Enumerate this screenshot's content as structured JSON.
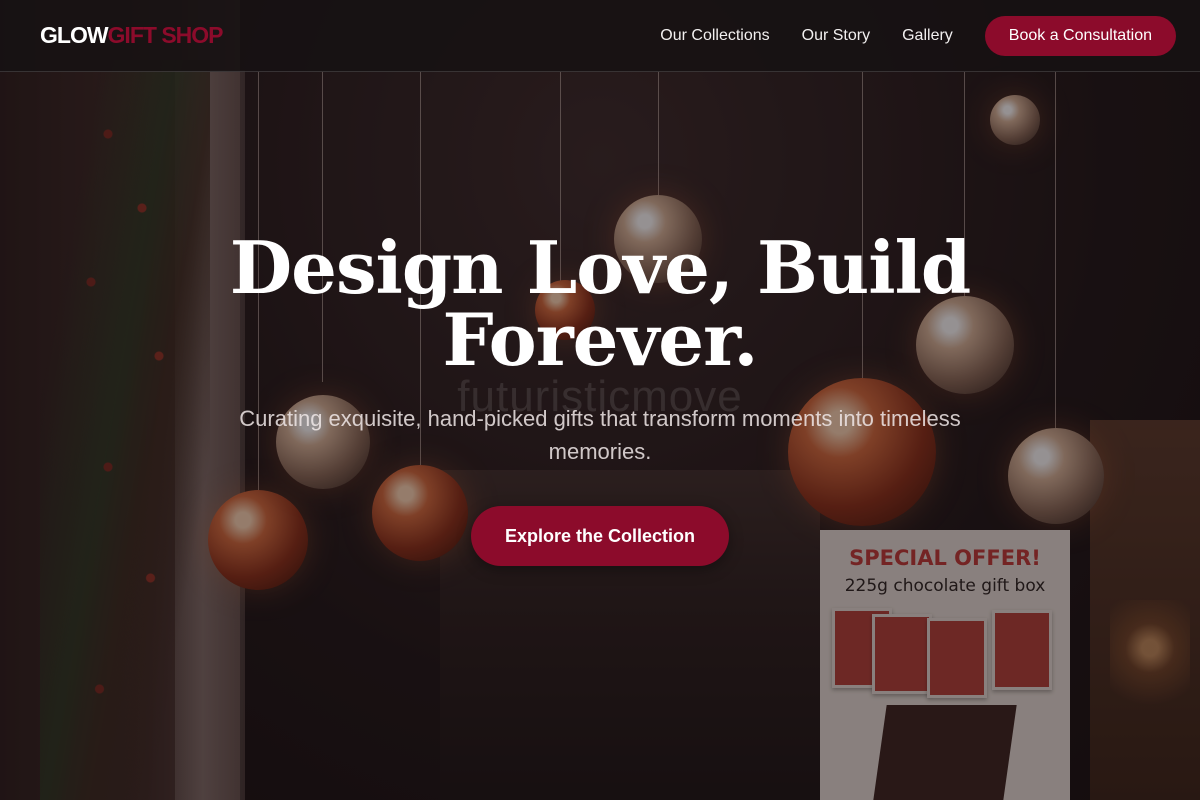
{
  "header": {
    "logo_main": "GLOW",
    "logo_accent": "GIFT SHOP",
    "nav": [
      {
        "label": "Our Collections"
      },
      {
        "label": "Our Story"
      },
      {
        "label": "Gallery"
      }
    ],
    "cta_label": "Book a Consultation"
  },
  "hero": {
    "title": "Design Love, Build Forever.",
    "subtitle": "Curating exquisite, hand-picked gifts that transform moments into timeless memories.",
    "watermark": "futuristicmove",
    "cta_label": "Explore the Collection"
  },
  "background": {
    "offer_title": "SPECIAL OFFER!",
    "offer_subtitle": "225g chocolate gift box"
  },
  "colors": {
    "accent": "#8c0b2b",
    "header_bg": "#161213",
    "text": "#ffffff"
  }
}
